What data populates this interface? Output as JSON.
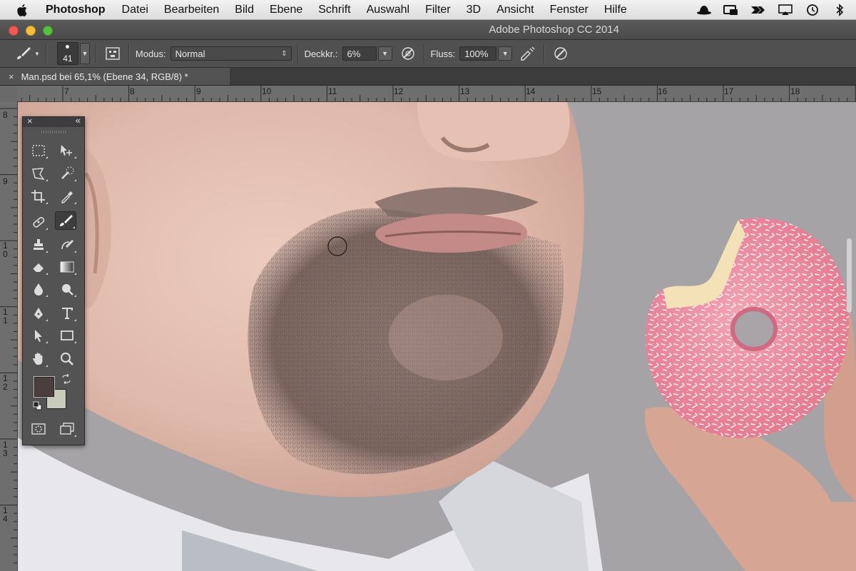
{
  "menubar": {
    "app_name": "Photoshop",
    "items": [
      "Datei",
      "Bearbeiten",
      "Bild",
      "Ebene",
      "Schrift",
      "Auswahl",
      "Filter",
      "3D",
      "Ansicht",
      "Fenster",
      "Hilfe"
    ]
  },
  "window": {
    "title": "Adobe Photoshop CC 2014"
  },
  "options": {
    "brush_size": "41",
    "mode_label": "Modus:",
    "mode_value": "Normal",
    "opacity_label": "Deckkr.:",
    "opacity_value": "6%",
    "flow_label": "Fluss:",
    "flow_value": "100%"
  },
  "document": {
    "tab_title": "Man.psd bei 65,1% (Ebene 34, RGB/8) *",
    "close_glyph": "×"
  },
  "ruler": {
    "top_labels": [
      "7",
      "8",
      "9",
      "10",
      "11",
      "12",
      "13",
      "14",
      "15",
      "16",
      "17",
      "18"
    ],
    "left_labels": [
      "8",
      "9",
      "1 0",
      "1 1",
      "1 2",
      "1 3",
      "1 4"
    ]
  },
  "colors": {
    "foreground": "#4a3e3e",
    "background": "#c9cbbd",
    "skin": "#e1bfb2",
    "backdrop": "#a6a3a6",
    "donut_icing": "#ec8ca0"
  },
  "toolbox": {
    "close_glyph": "×",
    "collapse_glyph": "«",
    "tools": [
      "rectangular-marquee",
      "move",
      "polygonal-lasso",
      "quick-selection",
      "crop",
      "eyedropper",
      "spot-healing",
      "brush",
      "clone-stamp",
      "history-brush",
      "eraser",
      "gradient",
      "blur",
      "dodge",
      "pen",
      "type",
      "path-selection",
      "rectangle",
      "hand",
      "zoom"
    ]
  }
}
